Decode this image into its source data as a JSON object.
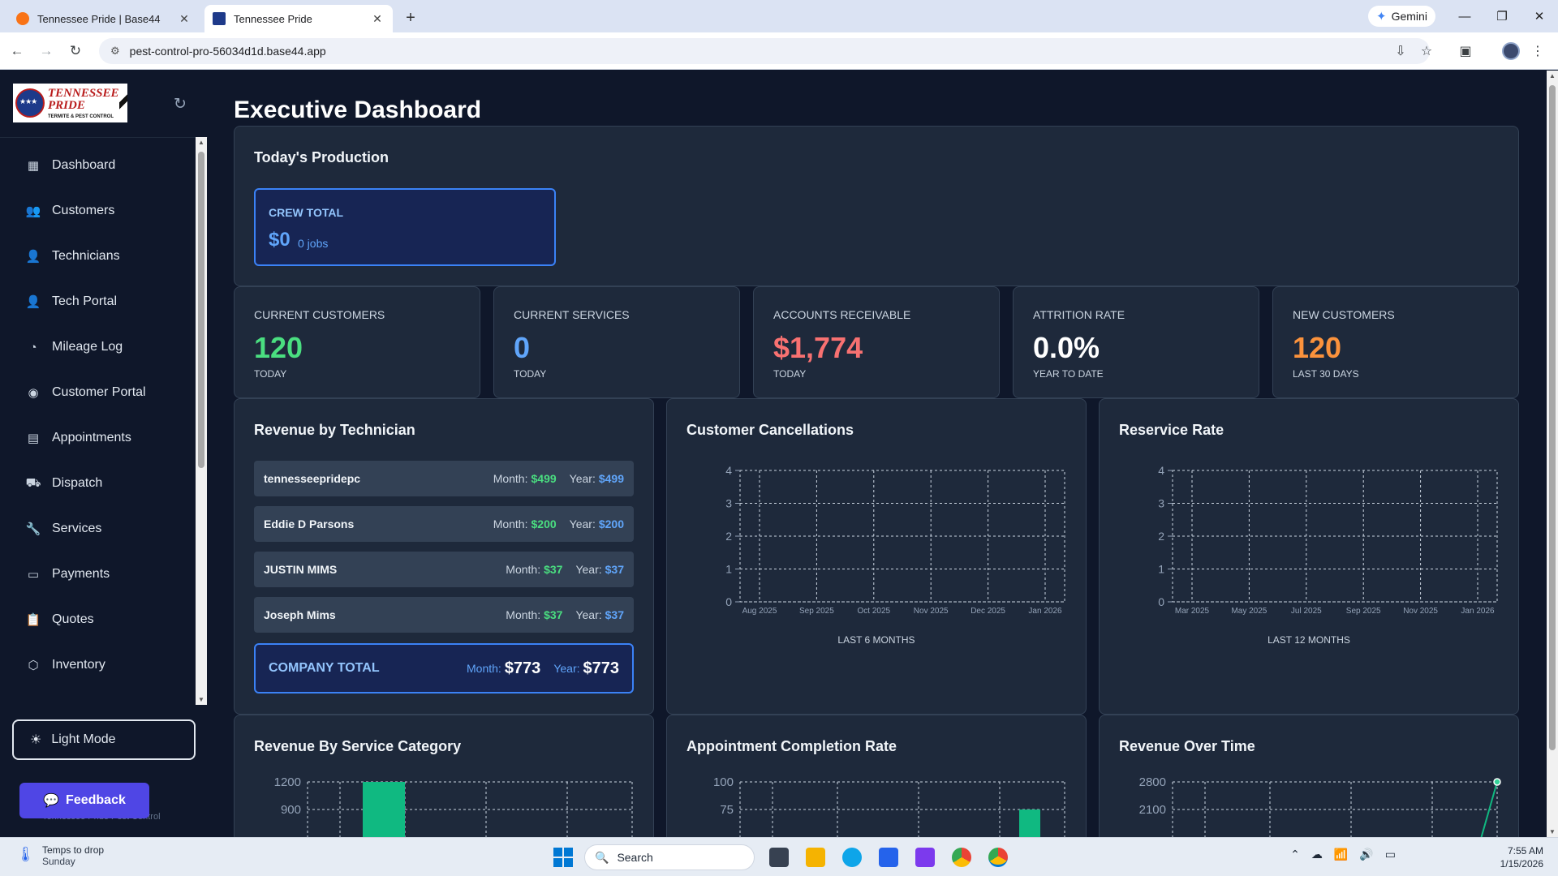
{
  "browser": {
    "tabs": [
      {
        "label": "Tennessee Pride | Base44",
        "active": false
      },
      {
        "label": "Tennessee Pride",
        "active": true
      }
    ],
    "url": "pest-control-pro-56034d1d.base44.app",
    "gemini_label": "Gemini"
  },
  "sidebar": {
    "logo_text": "TENNESSEE PRIDE",
    "logo_subtext": "TERMITE & PEST CONTROL",
    "items": [
      {
        "label": "Dashboard",
        "icon": "grid-icon"
      },
      {
        "label": "Customers",
        "icon": "users-icon"
      },
      {
        "label": "Technicians",
        "icon": "user-cog-icon"
      },
      {
        "label": "Tech Portal",
        "icon": "user-cog-icon"
      },
      {
        "label": "Mileage Log",
        "icon": "gauge-icon"
      },
      {
        "label": "Customer Portal",
        "icon": "user-circle-icon"
      },
      {
        "label": "Appointments",
        "icon": "calendar-icon"
      },
      {
        "label": "Dispatch",
        "icon": "truck-icon"
      },
      {
        "label": "Services",
        "icon": "wrench-icon"
      },
      {
        "label": "Payments",
        "icon": "message-square-icon"
      },
      {
        "label": "Quotes",
        "icon": "clipboard-icon"
      },
      {
        "label": "Inventory",
        "icon": "package-icon"
      }
    ],
    "light_mode_label": "Light Mode",
    "footer_text": "Tennessee Pride Pest Control",
    "feedback_label": "Feedback"
  },
  "main": {
    "title": "Executive Dashboard",
    "todays_production": {
      "title": "Today's Production",
      "crew_label": "CREW TOTAL",
      "crew_value": "$0",
      "crew_jobs": "0 jobs"
    },
    "stats": [
      {
        "label": "CURRENT CUSTOMERS",
        "value": "120",
        "sub": "TODAY",
        "color": "#4ade80"
      },
      {
        "label": "CURRENT SERVICES",
        "value": "0",
        "sub": "TODAY",
        "color": "#60a5fa"
      },
      {
        "label": "ACCOUNTS RECEIVABLE",
        "value": "$1,774",
        "sub": "TODAY",
        "color": "#f87171"
      },
      {
        "label": "ATTRITION RATE",
        "value": "0.0%",
        "sub": "YEAR TO DATE",
        "color": "#ffffff"
      },
      {
        "label": "NEW CUSTOMERS",
        "value": "120",
        "sub": "LAST 30 DAYS",
        "color": "#fb923c"
      }
    ],
    "revenue_by_technician": {
      "title": "Revenue by Technician",
      "month_label": "Month:",
      "year_label": "Year:",
      "rows": [
        {
          "name": "tennesseepridepc",
          "month": "$499",
          "year": "$499"
        },
        {
          "name": "Eddie D Parsons",
          "month": "$200",
          "year": "$200"
        },
        {
          "name": "JUSTIN MIMS",
          "month": "$37",
          "year": "$37"
        },
        {
          "name": "Joseph Mims",
          "month": "$37",
          "year": "$37"
        }
      ],
      "company_total_label": "COMPANY TOTAL",
      "company_month": "$773",
      "company_year": "$773"
    },
    "customer_cancellations": {
      "title": "Customer Cancellations",
      "caption": "LAST 6 MONTHS"
    },
    "reservice_rate": {
      "title": "Reservice Rate",
      "caption": "LAST 12 MONTHS"
    },
    "revenue_by_service_category": {
      "title": "Revenue By Service Category"
    },
    "appointment_completion_rate": {
      "title": "Appointment Completion Rate"
    },
    "revenue_over_time": {
      "title": "Revenue Over Time"
    }
  },
  "chart_data": [
    {
      "type": "line",
      "title": "Customer Cancellations",
      "x": [
        "Aug 2025",
        "Sep 2025",
        "Oct 2025",
        "Nov 2025",
        "Dec 2025",
        "Jan 2026"
      ],
      "series": [],
      "yticks": [
        0,
        1,
        2,
        3,
        4
      ],
      "ylim": [
        0,
        4
      ],
      "grid": true,
      "xlabel": "LAST 6 MONTHS"
    },
    {
      "type": "line",
      "title": "Reservice Rate",
      "x": [
        "Mar 2025",
        "May 2025",
        "Jul 2025",
        "Sep 2025",
        "Nov 2025",
        "Jan 2026"
      ],
      "series": [],
      "yticks": [
        0,
        1,
        2,
        3,
        4
      ],
      "ylim": [
        0,
        4
      ],
      "grid": true,
      "xlabel": "LAST 12 MONTHS"
    },
    {
      "type": "bar",
      "title": "Revenue By Service Category",
      "visible_yticks": [
        1200,
        900
      ],
      "values_visible": [
        1200
      ],
      "color": "#10b981",
      "grid": true
    },
    {
      "type": "bar",
      "title": "Appointment Completion Rate",
      "visible_yticks": [
        100,
        75
      ],
      "values_visible": [
        75
      ],
      "color": "#10b981",
      "grid": true
    },
    {
      "type": "line",
      "title": "Revenue Over Time",
      "visible_yticks": [
        2800,
        2100
      ],
      "values_visible": [
        2800
      ],
      "color": "#10b981",
      "grid": true
    }
  ],
  "taskbar": {
    "weather_line1": "Temps to drop",
    "weather_line2": "Sunday",
    "search_label": "Search",
    "time": "7:55 AM",
    "date": "1/15/2026"
  }
}
